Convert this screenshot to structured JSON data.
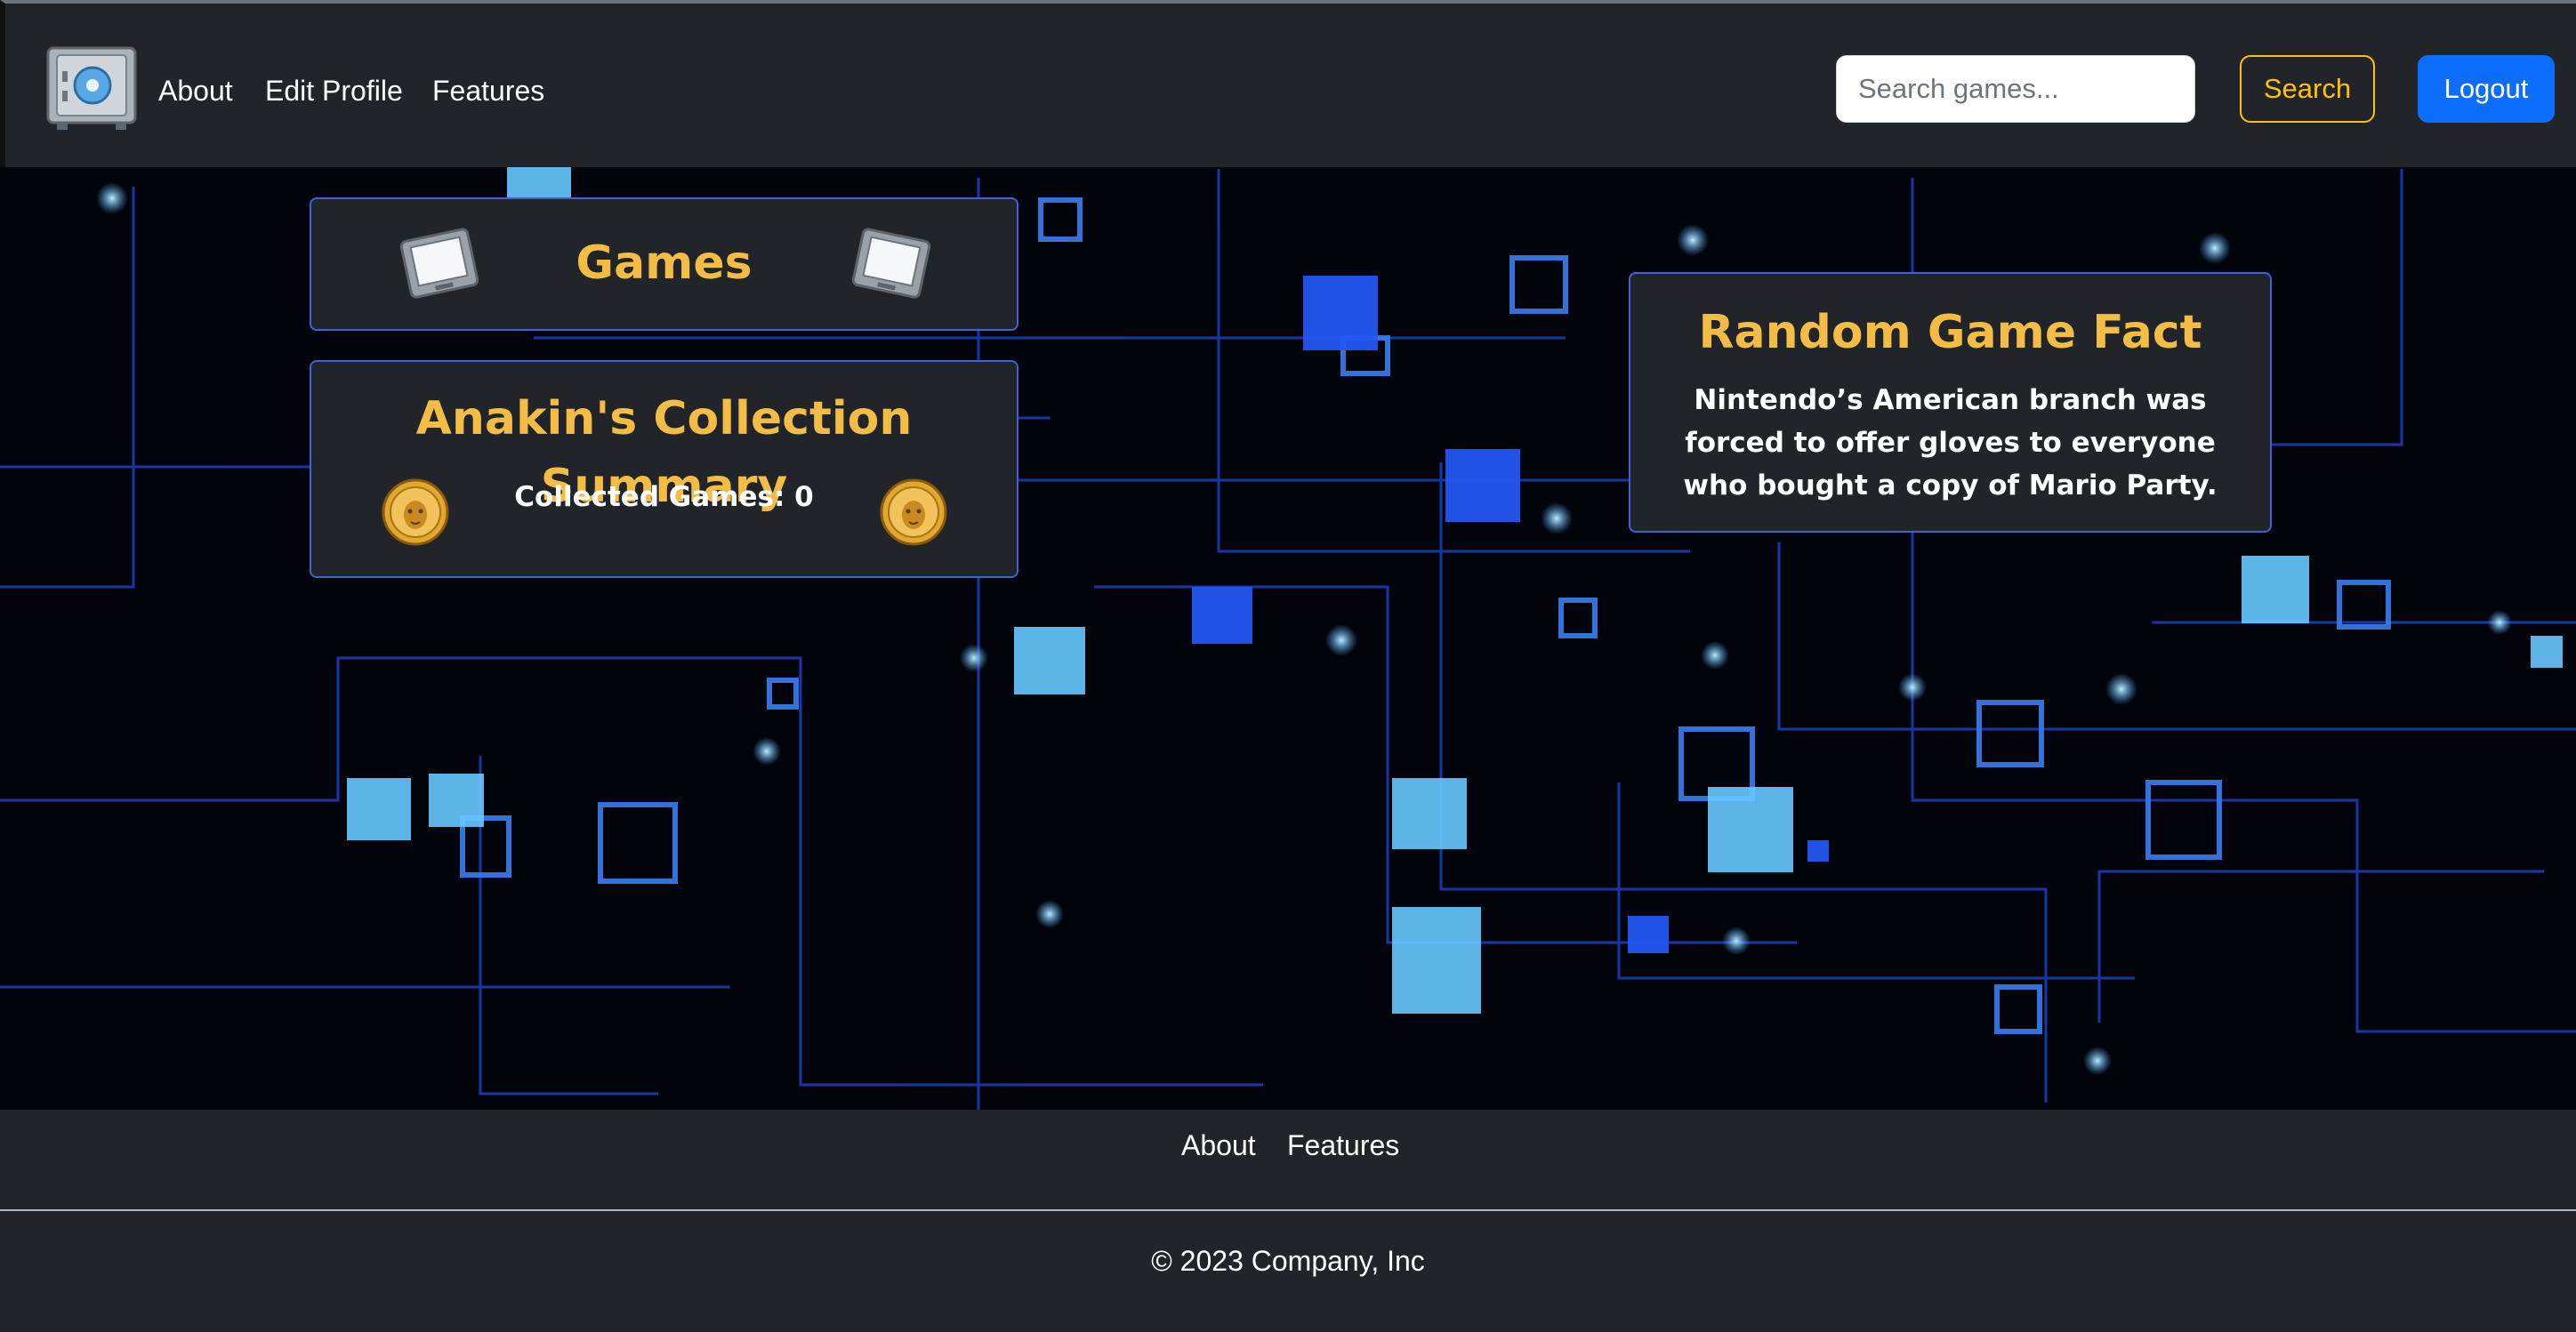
{
  "nav": {
    "links": [
      {
        "label": "About"
      },
      {
        "label": "Edit Profile"
      },
      {
        "label": "Features"
      }
    ],
    "search": {
      "placeholder": "Search games...",
      "value": ""
    },
    "search_label": "Search",
    "logout_label": "Logout"
  },
  "games_panel": {
    "title": "Games"
  },
  "summary_panel": {
    "title": "Anakin's Collection Summary",
    "count_text": "Collected Games: 0"
  },
  "fact_panel": {
    "title": "Random Game Fact",
    "text": "Nintendo’s American branch was forced to offer gloves to everyone who bought a copy of Mario Party."
  },
  "footer": {
    "links": [
      {
        "label": "About"
      },
      {
        "label": "Features"
      }
    ],
    "copyright": "© 2023 Company, Inc"
  },
  "colors": {
    "accent": "#f3bd45",
    "panel_bg": "#212529",
    "panel_border": "#3d63d8",
    "logout_bg": "#0d6efd",
    "search_outline": "#ffc107"
  },
  "icons": {
    "logo": "safe-vault-icon",
    "games": "game-cartridge-icon",
    "summary": "lion-coin-icon"
  }
}
